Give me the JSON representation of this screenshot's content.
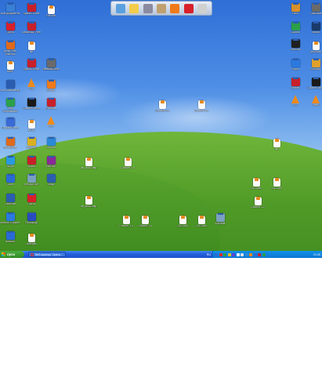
{
  "desktop": {
    "colors": {
      "sky": "#4f8fe6",
      "grass": "#4f9a27"
    },
    "icons": [
      {
        "label": "Мои документы",
        "glyph": "exe",
        "color": "#3a7fd6"
      },
      {
        "label": "Sparta Online",
        "glyph": "exe",
        "color": "#c8202a"
      },
      {
        "label": "File.exe",
        "glyph": "doc",
        "color": "#ffffff"
      },
      {
        "label": "Opera",
        "glyph": "exe",
        "color": "#d8202a"
      },
      {
        "label": "Kaspersky Free",
        "glyph": "exe",
        "color": "#c8202a"
      },
      {
        "label": "file",
        "glyph": "doc",
        "color": "#ffffff"
      },
      {
        "label": "Avast Free Antivirus",
        "glyph": "exe",
        "color": "#e06a1a"
      },
      {
        "label": "AIMP",
        "glyph": "doc",
        "color": "#ffffff"
      },
      {
        "label": "Uninstall Tool",
        "glyph": "exe",
        "color": "#2a8a3a"
      },
      {
        "label": "Sparta Online",
        "glyph": "exe",
        "color": "#c8202a"
      },
      {
        "label": "Network Drive",
        "glyph": "exe",
        "color": "#6a6a6a"
      },
      {
        "label": "Мой компьютер",
        "glyph": "exe",
        "color": "#2a5db0"
      },
      {
        "label": "VLC",
        "glyph": "cone",
        "color": "#f08a1a"
      },
      {
        "label": "Firefox",
        "glyph": "exe",
        "color": "#f07a1a"
      },
      {
        "label": "Total Commander",
        "glyph": "exe",
        "color": "#2aa04a"
      },
      {
        "label": "Counter Strike",
        "glyph": "exe",
        "color": "#1a1a1a"
      },
      {
        "label": "Rockstar",
        "glyph": "exe",
        "color": "#c8202a"
      },
      {
        "label": "Dr.Web CureIt",
        "glyph": "exe",
        "color": "#3a6ad6"
      },
      {
        "label": "file.txt",
        "glyph": "doc",
        "color": "#ffffff"
      },
      {
        "label": "VLC",
        "glyph": "cone",
        "color": "#f08a1a"
      },
      {
        "label": "Downloads",
        "glyph": "exe",
        "color": "#e06a1a"
      },
      {
        "label": "Desktop",
        "glyph": "exe",
        "color": "#d8b020"
      },
      {
        "label": "Chrome",
        "glyph": "exe",
        "color": "#2a8ad6"
      },
      {
        "label": "Skype",
        "glyph": "exe",
        "color": "#2a9ae0"
      },
      {
        "label": "Sparta",
        "glyph": "exe",
        "color": "#c8202a"
      },
      {
        "label": "WinRAR",
        "glyph": "exe",
        "color": "#8a2a9a"
      },
      {
        "label": "Game",
        "glyph": "exe",
        "color": "#2a6ad6"
      },
      {
        "label": "Recycle Bin",
        "glyph": "exe",
        "color": "#7aa0c0"
      },
      {
        "label": "Setup",
        "glyph": "exe",
        "color": "#2a5db0"
      },
      {
        "label": "Calendar",
        "glyph": "exe",
        "color": "#2a5db0"
      },
      {
        "label": "Opera",
        "glyph": "exe",
        "color": "#d8202a"
      },
      {
        "label": "Internet Explorer",
        "glyph": "exe",
        "color": "#2a7ae0"
      },
      {
        "label": "Photoshop",
        "glyph": "exe",
        "color": "#2a4ac0"
      },
      {
        "label": "Network",
        "glyph": "exe",
        "color": "#2a6ad6"
      },
      {
        "label": "Notepad",
        "glyph": "doc",
        "color": "#ffffff"
      },
      {
        "label": "Paint",
        "glyph": "exe",
        "color": "#d8902a"
      },
      {
        "label": "Calculator",
        "glyph": "exe",
        "color": "#6a6a6a"
      },
      {
        "label": "Games",
        "glyph": "exe",
        "color": "#2aa04a"
      },
      {
        "label": "Steam",
        "glyph": "exe",
        "color": "#1a3a6a"
      },
      {
        "label": "Terminal",
        "glyph": "exe",
        "color": "#202020"
      },
      {
        "label": "Unknown",
        "glyph": "doc",
        "color": "#ffffff"
      },
      {
        "label": "Player",
        "glyph": "exe",
        "color": "#2a7ae0"
      },
      {
        "label": "Shortcut",
        "glyph": "exe",
        "color": "#e0a02a"
      },
      {
        "label": "Reader",
        "glyph": "exe",
        "color": "#c8202a"
      },
      {
        "label": "Counter Strike",
        "glyph": "exe",
        "color": "#1a1a1a"
      },
      {
        "label": "VLC",
        "glyph": "cone",
        "color": "#f08a1a"
      },
      {
        "label": "Video",
        "glyph": "cone",
        "color": "#f08a1a"
      },
      {
        "label": "file",
        "glyph": "doc",
        "color": "#ffffff"
      },
      {
        "label": "de_dust2.bsp",
        "glyph": "doc",
        "color": "#ffffff"
      },
      {
        "label": "de_dust2.bsp",
        "glyph": "doc",
        "color": "#ffffff"
      },
      {
        "label": "Counter 1.6",
        "glyph": "doc",
        "color": "#ffffff"
      },
      {
        "label": "Counter 2.6",
        "glyph": "doc",
        "color": "#ffffff"
      },
      {
        "label": "Counter 1.6",
        "glyph": "doc",
        "color": "#ffffff"
      },
      {
        "label": "2013.doc",
        "glyph": "doc",
        "color": "#ffffff"
      },
      {
        "label": "2013.doc",
        "glyph": "doc",
        "color": "#ffffff"
      },
      {
        "label": "Counter 1.2",
        "glyph": "doc",
        "color": "#ffffff"
      },
      {
        "label": "Counter 1.3",
        "glyph": "doc",
        "color": "#ffffff"
      },
      {
        "label": "Counter 1.4",
        "glyph": "doc",
        "color": "#ffffff"
      },
      {
        "label": "2013.doc",
        "glyph": "doc",
        "color": "#ffffff"
      },
      {
        "label": "2013.doc",
        "glyph": "doc",
        "color": "#ffffff"
      },
      {
        "label": "Корзина",
        "glyph": "exe",
        "color": "#7aa0c0"
      }
    ]
  },
  "quick_dock": {
    "items": [
      {
        "name": "itunes-icon",
        "color": "#5aa0e0"
      },
      {
        "name": "folder-icon",
        "color": "#f2cc4a"
      },
      {
        "name": "tool-icon",
        "color": "#8a8aa0"
      },
      {
        "name": "tool-icon-2",
        "color": "#c0a070"
      },
      {
        "name": "firefox-icon",
        "color": "#f07a1a"
      },
      {
        "name": "opera-icon",
        "color": "#d8202a"
      },
      {
        "name": "phone-icon",
        "color": "#d0d0d0"
      }
    ]
  },
  "taskbar": {
    "start_label": "пуск",
    "task_label": "Веб-камера: Opera...",
    "lang": "RU",
    "clock": "21:05",
    "tray_colors": [
      "#2a6ad6",
      "#e02a2a",
      "#2aa04a",
      "#f0c020",
      "#6a3ad6",
      "#ffffff",
      "#e0e0e0",
      "#2a8ad6",
      "#f08a1a",
      "#2a6ad6",
      "#c8202a",
      "#2aa04a"
    ]
  }
}
